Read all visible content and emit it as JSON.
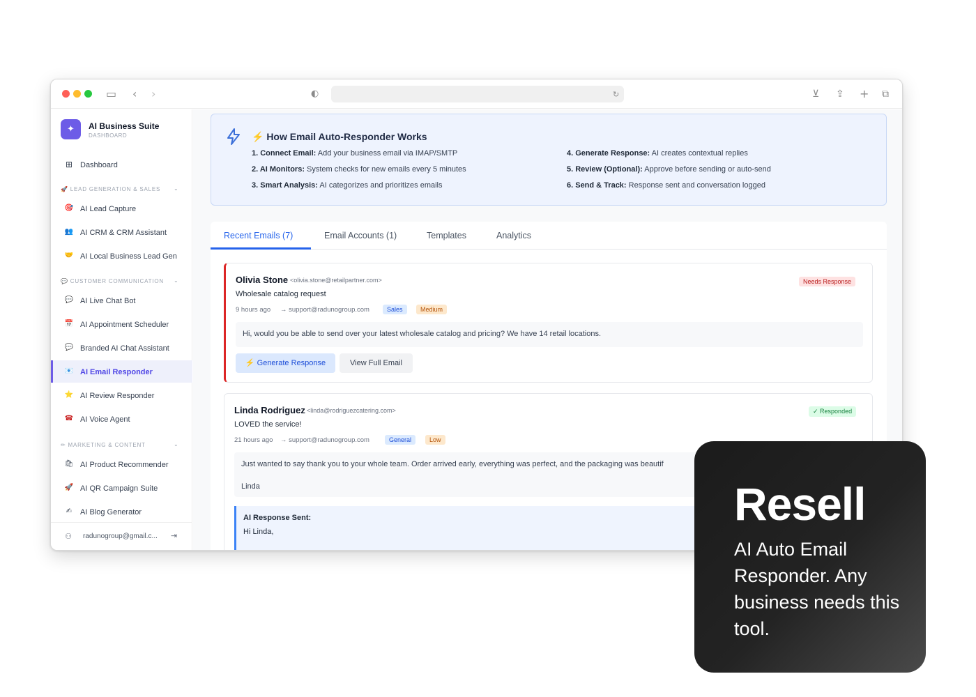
{
  "app": {
    "brand_title": "AI Business Suite",
    "brand_subtitle": "DASHBOARD"
  },
  "sidebar": {
    "dashboard": "Dashboard",
    "sections": [
      {
        "label": "🚀 LEAD GENERATION & SALES",
        "items": [
          {
            "icon": "🎯",
            "label": "AI Lead Capture"
          },
          {
            "icon": "👥",
            "label": "AI CRM & CRM Assistant"
          },
          {
            "icon": "🤝",
            "label": "AI Local Business Lead Gen"
          }
        ]
      },
      {
        "label": "💬 CUSTOMER COMMUNICATION",
        "items": [
          {
            "icon": "💬",
            "label": "AI Live Chat Bot"
          },
          {
            "icon": "📅",
            "label": "AI Appointment Scheduler"
          },
          {
            "icon": "💬",
            "label": "Branded AI Chat Assistant"
          },
          {
            "icon": "📧",
            "label": "AI Email Responder"
          },
          {
            "icon": "⭐",
            "label": "AI Review Responder"
          },
          {
            "icon": "☎",
            "label": "AI Voice Agent"
          }
        ]
      },
      {
        "label": "✏ MARKETING & CONTENT",
        "items": [
          {
            "icon": "🛍",
            "label": "AI Product Recommender"
          },
          {
            "icon": "🚀",
            "label": "AI QR Campaign Suite"
          },
          {
            "icon": "✍",
            "label": "AI Blog Generator"
          }
        ]
      }
    ],
    "user_email": "radunogroup@gmail.c..."
  },
  "info": {
    "title": "⚡ How Email Auto-Responder Works",
    "steps": [
      {
        "bold": "1. Connect Email:",
        "text": " Add your business email via IMAP/SMTP"
      },
      {
        "bold": "2. AI Monitors:",
        "text": " System checks for new emails every 5 minutes"
      },
      {
        "bold": "3. Smart Analysis:",
        "text": " AI categorizes and prioritizes emails"
      },
      {
        "bold": "4. Generate Response:",
        "text": " AI creates contextual replies"
      },
      {
        "bold": "5. Review (Optional):",
        "text": " Approve before sending or auto-send"
      },
      {
        "bold": "6. Send & Track:",
        "text": " Response sent and conversation logged"
      }
    ]
  },
  "tabs": [
    "Recent Emails (7)",
    "Email Accounts (1)",
    "Templates",
    "Analytics"
  ],
  "emails": [
    {
      "name": "Olivia Stone",
      "email": "<olivia.stone@retailpartner.com>",
      "subject": "Wholesale catalog request",
      "time": "9 hours ago",
      "to": "→ support@radunogroup.com",
      "category": "Sales",
      "priority": "Medium",
      "status": "Needs Response",
      "body": "Hi, would you be able to send over your latest wholesale catalog and pricing? We have 14 retail locations.",
      "btn_generate": "⚡ Generate Response",
      "btn_view": "View Full Email"
    },
    {
      "name": "Linda Rodriguez",
      "email": "<linda@rodriguezcatering.com>",
      "subject": "LOVED the service!",
      "time": "21 hours ago",
      "to": "→ support@radunogroup.com",
      "category": "General",
      "priority": "Low",
      "status": "✓ Responded",
      "body": "Just wanted to say thank you to your whole team. Order arrived early, everything was perfect, and the packaging was beautif",
      "signature": "Linda",
      "response_label": "AI Response Sent:",
      "response_text": "Hi Linda,"
    }
  ],
  "promo": {
    "title": "Resell",
    "body": "AI Auto Email Responder. Any business needs this tool."
  }
}
